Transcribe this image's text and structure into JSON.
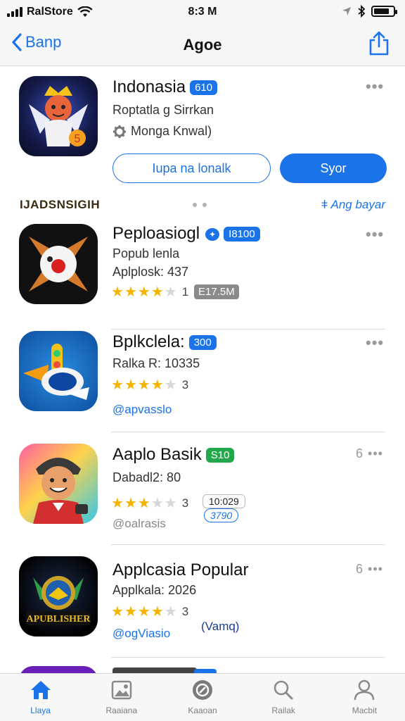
{
  "status_bar": {
    "carrier": "RalStore",
    "time": "8:3 M"
  },
  "nav": {
    "back_label": "Banp",
    "title": "Agoe"
  },
  "featured": {
    "name": "Indonasia",
    "badge": "610",
    "subtitle": "Roptatla g Sirrkan",
    "developer": "Monga Knwal)",
    "secondary_button": "Iupa na lonalk",
    "primary_button": "Syor"
  },
  "section": {
    "title": "IJADSNSIGIH",
    "see_all": "Ang bayar"
  },
  "apps": [
    {
      "name": "Peploasiogl",
      "badge": "I8100",
      "line1": "Popub lenla",
      "line2": "Aplplosk: 437",
      "rating": "1",
      "extra": "E17.5M"
    },
    {
      "name": "Bplkclela:",
      "badge": "300",
      "line1": "Ralka R: 10335",
      "rating": "3",
      "link": "@apvasslo"
    },
    {
      "name": "Aaplo Basik",
      "badge": "S10",
      "line1": "Dabadl2: 80",
      "rating": "3",
      "extra": "10:029",
      "extra2": "3790",
      "link": "@oalrasis"
    },
    {
      "name": "Applcasia Popular",
      "line1": "Applkala: 2026",
      "rating": "3",
      "extra": "(Vamq)",
      "link": "@ogViasio"
    }
  ],
  "row_more": [
    "6",
    "6"
  ],
  "tabs": [
    {
      "label": "Llaya"
    },
    {
      "label": "Raaiana"
    },
    {
      "label": "Kaaoan"
    },
    {
      "label": "Railak"
    },
    {
      "label": "Macbit"
    }
  ],
  "colors": {
    "accent": "#1a73e8",
    "star": "#f4b400",
    "green_badge": "#22a84a"
  },
  "icons": [
    "signal-icon",
    "wifi-icon",
    "location-icon",
    "bluetooth-icon",
    "battery-icon",
    "chevron-left-icon",
    "share-icon",
    "gear-icon",
    "more-icon",
    "home-icon",
    "photo-icon",
    "search-icon",
    "profile-icon"
  ]
}
